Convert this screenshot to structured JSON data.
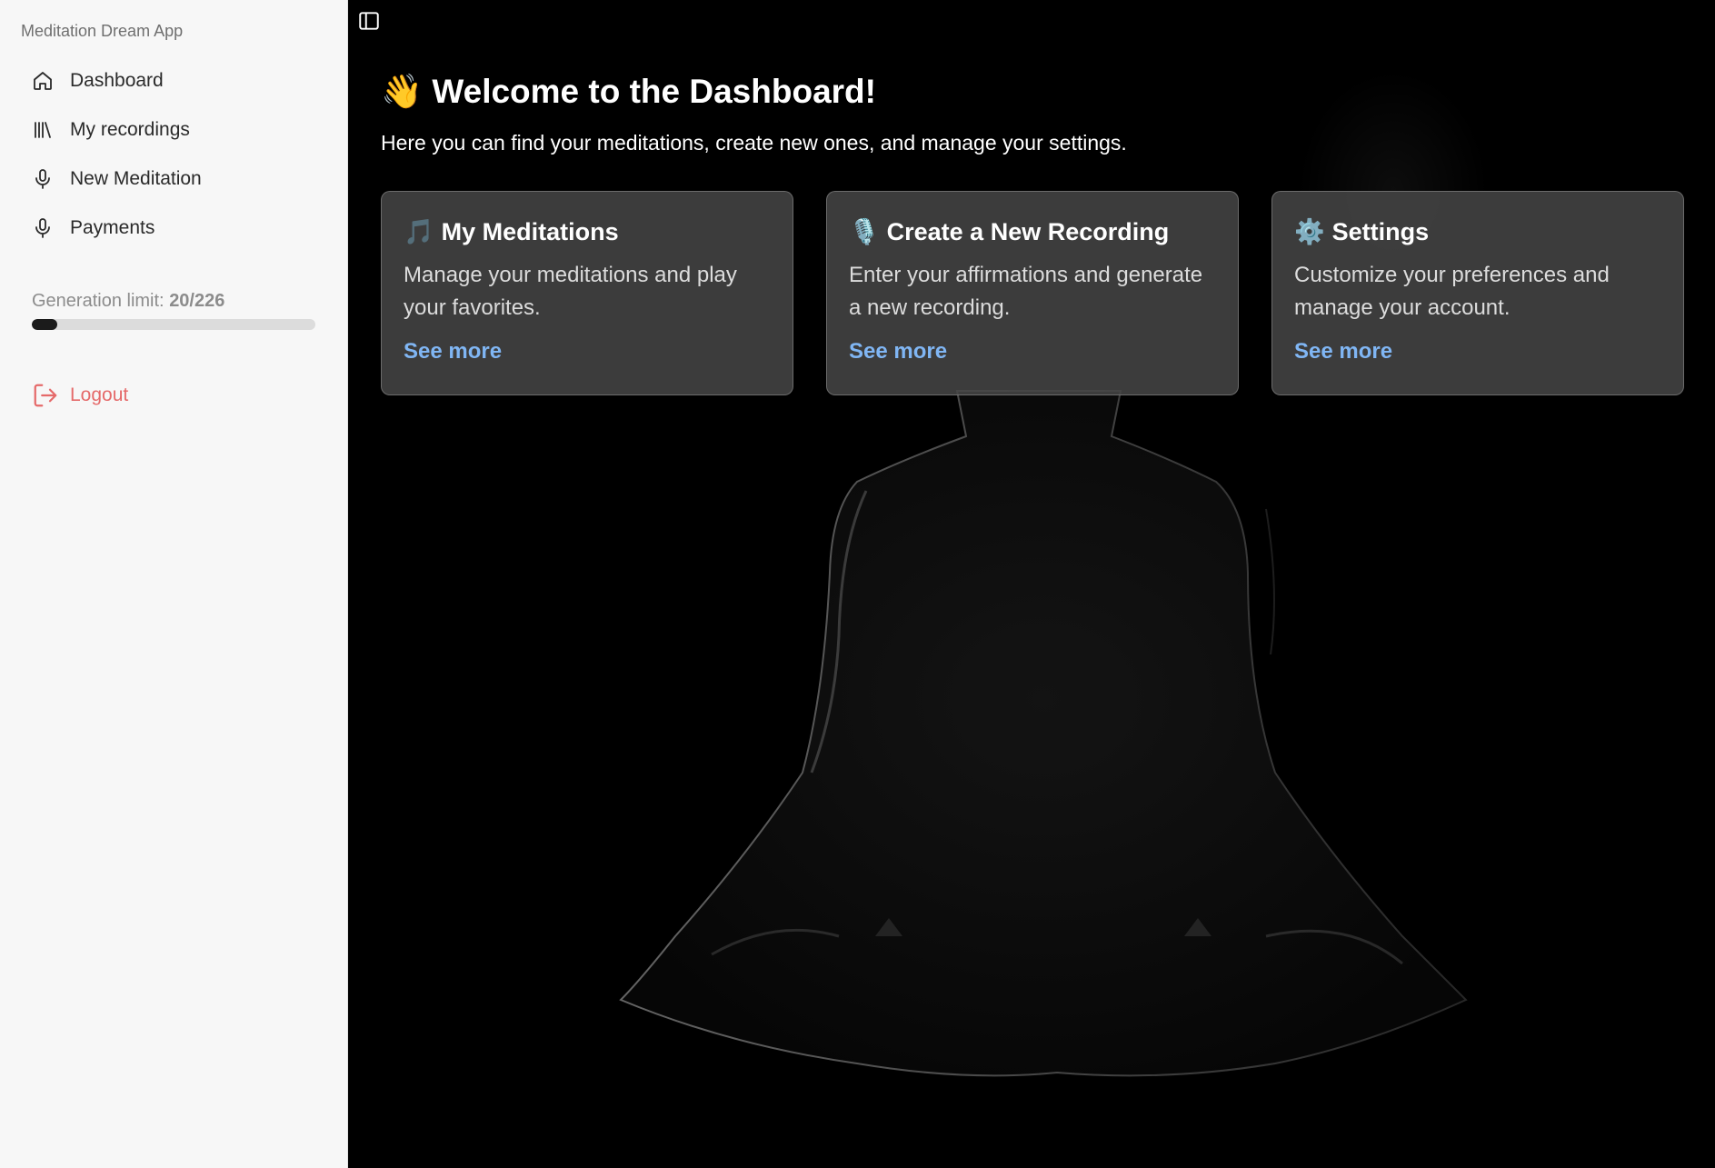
{
  "sidebar": {
    "app_title": "Meditation Dream App",
    "nav": [
      {
        "label": "Dashboard",
        "icon": "home-icon"
      },
      {
        "label": "My recordings",
        "icon": "library-icon"
      },
      {
        "label": "New Meditation",
        "icon": "microphone-icon"
      },
      {
        "label": "Payments",
        "icon": "microphone-icon"
      }
    ],
    "generation_limit": {
      "label": "Generation limit:",
      "value": "20/226",
      "used": 20,
      "total": 226
    },
    "logout_label": "Logout"
  },
  "main": {
    "welcome_emoji": "👋",
    "welcome_title": "Welcome to the Dashboard!",
    "subtitle": "Here you can find your meditations, create new ones, and manage your settings.",
    "cards": [
      {
        "emoji": "🎵",
        "title": "My Meditations",
        "description": "Manage your meditations and play your favorites.",
        "link": "See more"
      },
      {
        "emoji": "🎙️",
        "title": "Create a New Recording",
        "description": "Enter your affirmations and generate a new recording.",
        "link": "See more"
      },
      {
        "emoji": "⚙️",
        "title": "Settings",
        "description": "Customize your preferences and manage your account.",
        "link": "See more"
      }
    ]
  },
  "colors": {
    "link": "#80b6f4",
    "logout": "#e56a6a",
    "sidebar_bg": "#f7f7f7",
    "main_bg": "#000000"
  }
}
